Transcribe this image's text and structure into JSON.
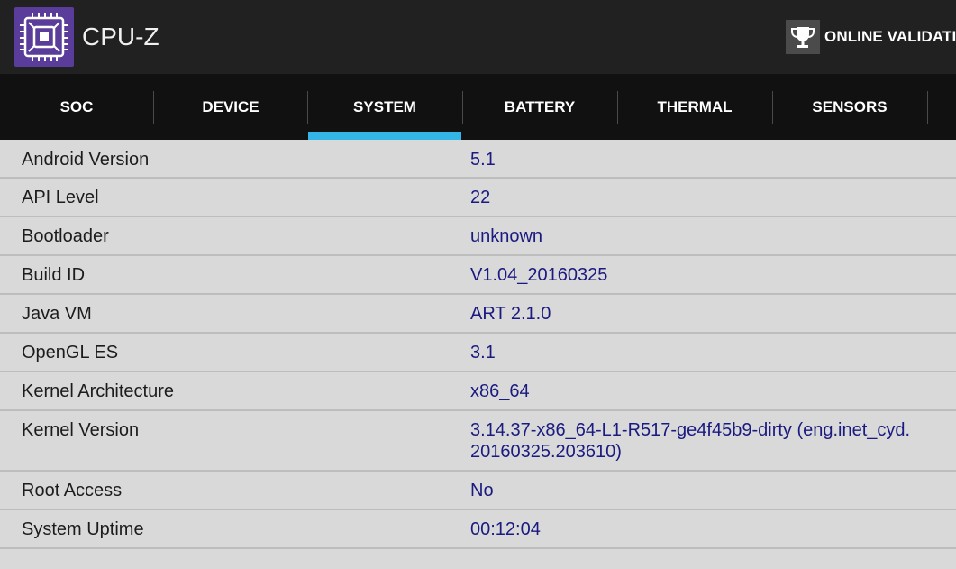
{
  "app": {
    "title": "CPU-Z",
    "icon": "cpu-chip-icon",
    "colors": {
      "actionbar": "#212121",
      "tabbar": "#111111",
      "accent": "#33b5e5",
      "icon_bg": "#5a3d9a",
      "value_text": "#1a1a80"
    }
  },
  "header": {
    "validation_label": "ONLINE VALIDATIO",
    "validation_icon": "trophy-icon"
  },
  "tabs": [
    {
      "label": "SOC",
      "selected": false
    },
    {
      "label": "DEVICE",
      "selected": false
    },
    {
      "label": "SYSTEM",
      "selected": true
    },
    {
      "label": "BATTERY",
      "selected": false
    },
    {
      "label": "THERMAL",
      "selected": false
    },
    {
      "label": "SENSORS",
      "selected": false
    }
  ],
  "system": {
    "rows": [
      {
        "label": "Android Version",
        "value": "5.1"
      },
      {
        "label": "API Level",
        "value": "22"
      },
      {
        "label": "Bootloader",
        "value": "unknown"
      },
      {
        "label": "Build ID",
        "value": "V1.04_20160325"
      },
      {
        "label": "Java VM",
        "value": "ART 2.1.0"
      },
      {
        "label": "OpenGL ES",
        "value": "3.1"
      },
      {
        "label": "Kernel Architecture",
        "value": "x86_64"
      },
      {
        "label": "Kernel Version",
        "value": "3.14.37-x86_64-L1-R517-ge4f45b9-dirty (eng.inet_cyd.\n20160325.203610)"
      },
      {
        "label": "Root Access",
        "value": "No"
      },
      {
        "label": "System Uptime",
        "value": "00:12:04"
      }
    ]
  }
}
